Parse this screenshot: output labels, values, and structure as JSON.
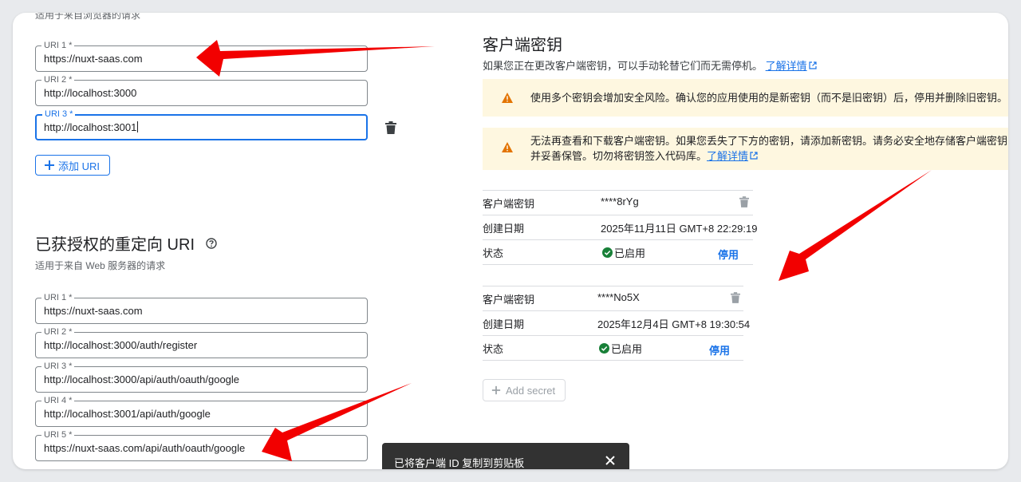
{
  "js_origins": {
    "caption": "适用于来自浏览器的请求",
    "fields": [
      {
        "label": "URI 1 *",
        "value": "https://nuxt-saas.com"
      },
      {
        "label": "URI 2 *",
        "value": "http://localhost:3000"
      },
      {
        "label": "URI 3 *",
        "value": "http://localhost:3001"
      }
    ],
    "add_button": "添加 URI"
  },
  "redirect_uris": {
    "title": "已获授权的重定向 URI",
    "caption": "适用于来自 Web 服务器的请求",
    "fields": [
      {
        "label": "URI 1 *",
        "value": "https://nuxt-saas.com"
      },
      {
        "label": "URI 2 *",
        "value": "http://localhost:3000/auth/register"
      },
      {
        "label": "URI 3 *",
        "value": "http://localhost:3000/api/auth/oauth/google"
      },
      {
        "label": "URI 4 *",
        "value": "http://localhost:3001/api/auth/google"
      },
      {
        "label": "URI 5 *",
        "value": "https://nuxt-saas.com/api/auth/oauth/google"
      }
    ]
  },
  "client_secrets": {
    "title": "客户端密钥",
    "description": "如果您正在更改客户端密钥，可以手动轮替它们而无需停机。",
    "learn_more": "了解详情",
    "warning_1": "使用多个密钥会增加安全风险。确认您的应用使用的是新密钥（而不是旧密钥）后，停用并删除旧密钥。",
    "warning_2_line1": "无法再查看和下载客户端密钥。如果您丢失了下方的密钥，请添加新密钥。请务必安全地存储客户端密钥，",
    "warning_2_line2": "并妥善保管。切勿将密钥签入代码库。",
    "warning_2_link": "了解详情",
    "secrets": [
      {
        "secret_label": "客户端密钥",
        "secret_value": "****8rYg",
        "date_label": "创建日期",
        "date_value": "2025年11月11日 GMT+8 22:29:19",
        "status_label": "状态",
        "status_value": "已启用",
        "disable": "停用"
      },
      {
        "secret_label": "客户端密钥",
        "secret_value": "****No5X",
        "date_label": "创建日期",
        "date_value": "2025年12月4日 GMT+8 19:30:54",
        "status_label": "状态",
        "status_value": "已启用",
        "disable": "停用"
      }
    ],
    "add_secret": "Add secret"
  },
  "snackbar": {
    "message": "已将客户端 ID 复制到剪贴板"
  },
  "colors": {
    "accent": "#1a73e8",
    "warning_bg": "#fef7e0",
    "warning_icon": "#e37400",
    "success": "#188038",
    "annotation_arrow": "#f20000"
  }
}
